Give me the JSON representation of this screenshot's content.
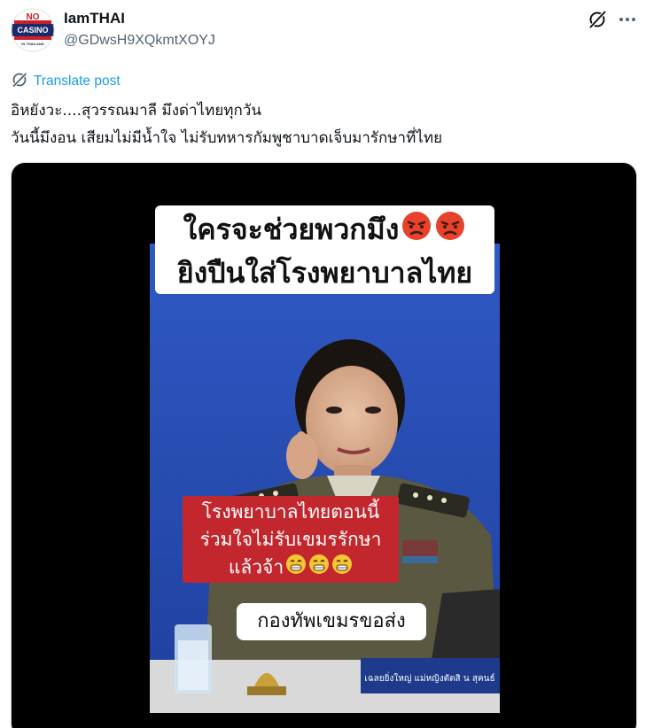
{
  "author": {
    "display_name": "IamTHAI",
    "handle": "@GDwsH9XQkmtXOYJ",
    "avatar_text": [
      "NO",
      "CASINO",
      "IN THAILAND"
    ]
  },
  "actions": {
    "grok_icon": "grok-icon",
    "more_icon": "more-icon"
  },
  "translate": {
    "label": "Translate post"
  },
  "post": {
    "lines": [
      "อิหยังวะ....สุวรรณมาลี มึงด่าไทยทุกวัน",
      "วันนี้มึงอน เสียมไม่มีน้ำใจ ไม่รับทหารกัมพูชาบาดเจ็บมารักษาที่ไทย"
    ]
  },
  "media": {
    "title_lines": [
      "ใครจะช่วยพวกมึง",
      "ยิงปืนใส่โรงพยาบาลไทย"
    ],
    "red_caption_lines": [
      "โรงพยาบาลไทยตอนนี้",
      "ร่วมใจไม่รับเขมรรักษา",
      "แล้วจ้า"
    ],
    "white_caption": "กองทัพเขมรขอส่ง",
    "nameplate_text": "เฉลยยิ่งใหญ่ แม่หญิงตัดสิ น สุคนธ์"
  },
  "colors": {
    "link": "#1d9bf0",
    "secondary_text": "#536471",
    "caption_red": "#c2272d",
    "video_bg": "#2a4fb8"
  }
}
